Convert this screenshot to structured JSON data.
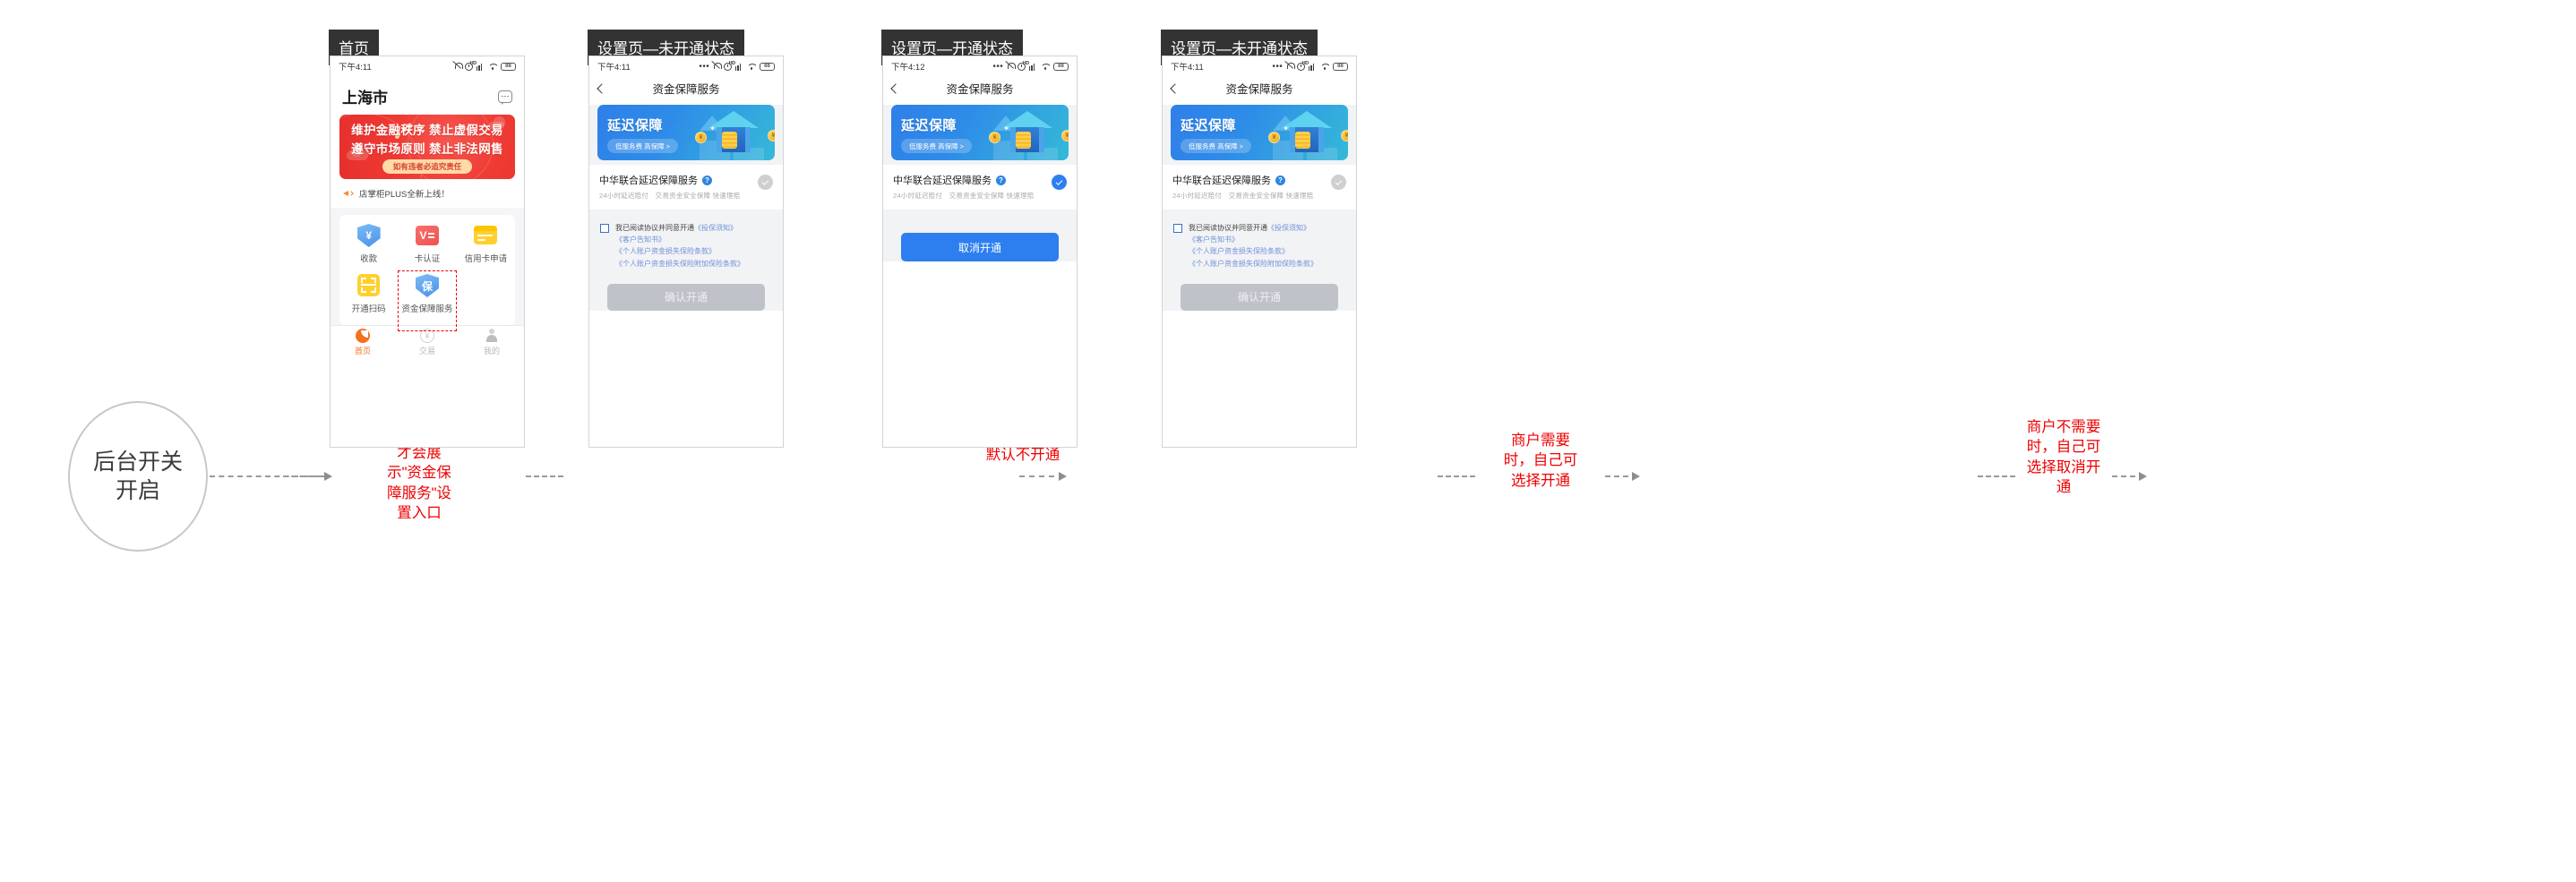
{
  "start_node": {
    "line1": "后台开关",
    "line2": "开启"
  },
  "annotations": [
    {
      "id": "a1",
      "text": "后台开关开\n启，APP上\n才会展\n示\"资金保\n障服务\"设\n置入口"
    },
    {
      "id": "a2",
      "text": "默认不开通"
    },
    {
      "id": "a3",
      "text": "商户需要\n时，自己可\n选择开通"
    },
    {
      "id": "a4",
      "text": "商户不需要\n时，自己可\n选择取消开\n通"
    }
  ],
  "screens": [
    {
      "label": "首页",
      "statusbar": {
        "time": "下午4:11",
        "battery": "88",
        "hd": "HD",
        "dots": ""
      },
      "city": "上海市",
      "banner": {
        "line1": "维护金融秩序  禁止虚假交易",
        "line2": "遵守市场原则  禁止非法网售",
        "pill": "如有违者必追究责任"
      },
      "notice": "店掌柜PLUS全新上线！",
      "grid": [
        {
          "label": "收款",
          "icon": "shield-yen-icon",
          "glyph": "¥"
        },
        {
          "label": "卡认证",
          "icon": "card-verify-icon",
          "glyph": "V"
        },
        {
          "label": "信用卡申请",
          "icon": "credit-card-icon",
          "glyph": ""
        },
        {
          "label": "开通扫码",
          "icon": "scan-qr-icon",
          "glyph": ""
        },
        {
          "label": "资金保障服务",
          "icon": "shield-protect-icon",
          "glyph": "保"
        }
      ],
      "tabs": [
        {
          "label": "首页",
          "icon": "home-icon",
          "active": true
        },
        {
          "label": "交易",
          "icon": "trade-icon",
          "active": false
        },
        {
          "label": "我的",
          "icon": "profile-icon",
          "active": false
        }
      ]
    },
    {
      "label": "设置页—未开通状态",
      "statusbar": {
        "time": "下午4:11",
        "battery": "88",
        "hd": "HD",
        "dots": "•••"
      },
      "nav_title": "资金保障服务",
      "banner": {
        "title": "延迟保障",
        "pill": "低服务费 高保障 >",
        "coin": "¥"
      },
      "service": {
        "title": "中华联合延迟保障服务",
        "subtitle": "24小时延迟赔付　交易资金安全保障 快速理赔",
        "activated": false
      },
      "agreement": {
        "lead": "我已阅读协议并同意开通",
        "links": [
          "《投保须知》",
          "《客户告知书》",
          "《个人账户资金损失保险条款》",
          "《个人账户资金损失保险附加保险条款》"
        ]
      },
      "action_button": {
        "label": "确认开通",
        "state": "disabled"
      }
    },
    {
      "label": "设置页—开通状态",
      "statusbar": {
        "time": "下午4:12",
        "battery": "88",
        "hd": "HD",
        "dots": "•••"
      },
      "nav_title": "资金保障服务",
      "banner": {
        "title": "延迟保障",
        "pill": "低服务费 高保障 >",
        "coin": "¥"
      },
      "service": {
        "title": "中华联合延迟保障服务",
        "subtitle": "24小时延迟赔付　交易资金安全保障 快速理赔",
        "activated": true
      },
      "action_button": {
        "label": "取消开通",
        "state": "primary"
      }
    },
    {
      "label": "设置页—未开通状态",
      "statusbar": {
        "time": "下午4:11",
        "battery": "88",
        "hd": "HD",
        "dots": "•••"
      },
      "nav_title": "资金保障服务",
      "banner": {
        "title": "延迟保障",
        "pill": "低服务费 高保障 >",
        "coin": "¥"
      },
      "service": {
        "title": "中华联合延迟保障服务",
        "subtitle": "24小时延迟赔付　交易资金安全保障 快速理赔",
        "activated": false
      },
      "agreement": {
        "lead": "我已阅读协议并同意开通",
        "links": [
          "《投保须知》",
          "《客户告知书》",
          "《个人账户资金损失保险条款》",
          "《个人账户资金损失保险附加保险条款》"
        ]
      },
      "action_button": {
        "label": "确认开通",
        "state": "disabled"
      }
    }
  ],
  "colors": {
    "annotation_red": "#ef0000",
    "accent_blue": "#2d7ff0",
    "banner_red": "#ef3b34",
    "tab_active": "#f5711f"
  }
}
